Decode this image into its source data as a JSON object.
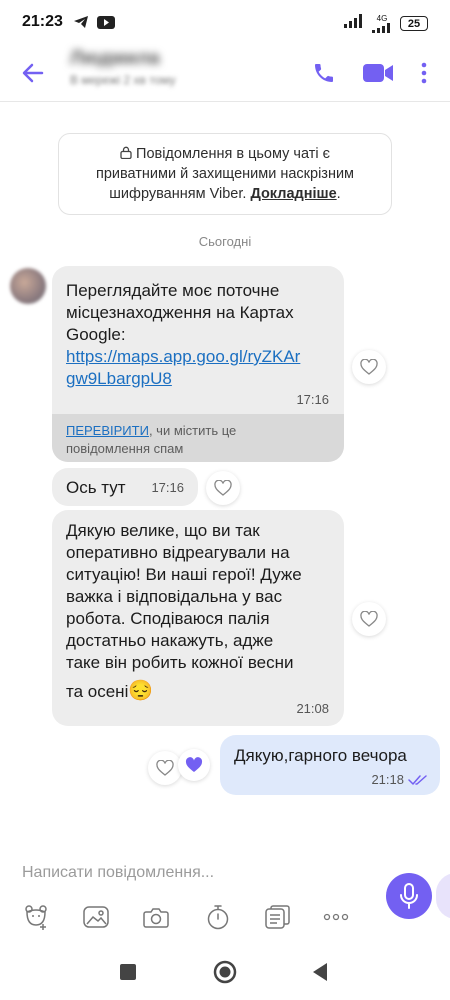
{
  "status_bar": {
    "time": "21:23",
    "network": "4G",
    "battery": "25"
  },
  "header": {
    "contact_name": "Людмила",
    "contact_status": "В мережі 2 хв тому"
  },
  "encryption_notice": {
    "line1": "Повідомлення в цьому чаті є",
    "line2": "приватними й захищеними наскрізним",
    "line3_prefix": "шифруванням Viber. ",
    "more_link": "Докладніше",
    "line3_suffix": "."
  },
  "date_separator": "Сьогодні",
  "messages": [
    {
      "direction": "incoming",
      "text_lines": [
        "Переглядайте моє поточне",
        "місцезнаходження на Картах",
        "Google:"
      ],
      "link_lines": [
        "https://maps.app.goo.gl/ryZKAr",
        "gw9LbargpU8"
      ],
      "time": "17:16",
      "spam_check_link": "ПЕРЕВІРИТИ",
      "spam_check_text": ", чи містить це",
      "spam_check_text2": "повідомлення спам"
    },
    {
      "direction": "incoming",
      "text": "Ось тут",
      "time": "17:16"
    },
    {
      "direction": "incoming",
      "text_lines": [
        "Дякую велике, що ви так",
        "оперативно відреагували на",
        "ситуацію! Ви наші герої! Дуже",
        "важка і відповідальна у вас",
        "робота. Сподіваюся палія",
        "достатньо накажуть, адже",
        "таке він робить кожної весни",
        "та осені"
      ],
      "emoji": "😔",
      "time": "21:08"
    },
    {
      "direction": "outgoing",
      "text": "Дякую,гарного вечора",
      "time": "21:18"
    }
  ],
  "composer": {
    "placeholder": "Написати повідомлення..."
  },
  "colors": {
    "accent": "#7360f2",
    "incoming_bubble": "#ededed",
    "outgoing_bubble": "#dfe9fb",
    "link": "#1b6fc1"
  }
}
